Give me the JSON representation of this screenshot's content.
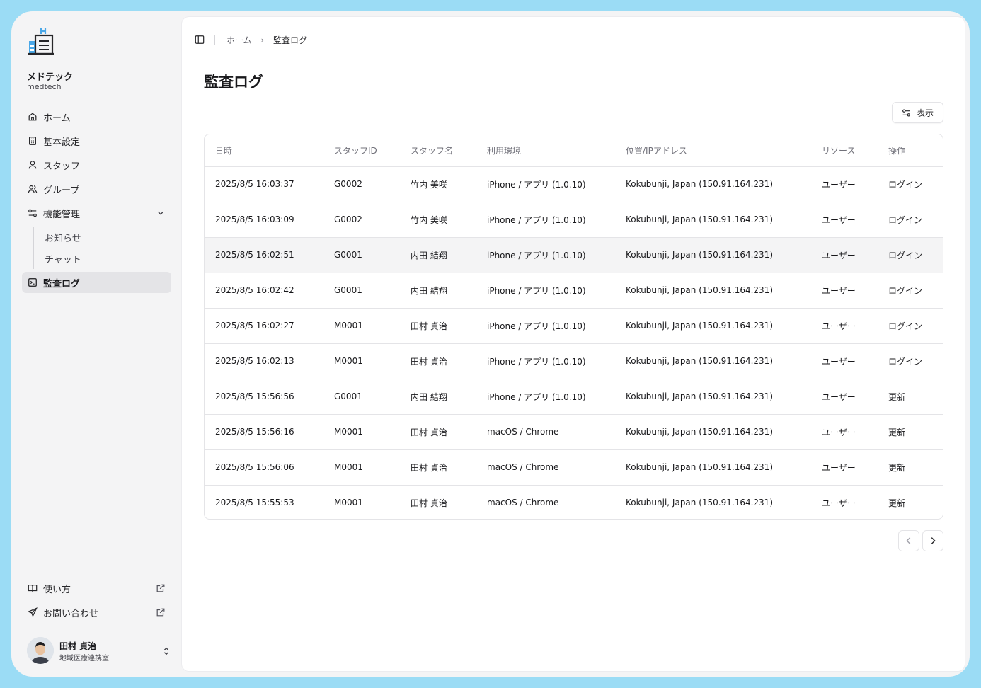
{
  "brand": {
    "name": "メドテック",
    "sub": "medtech"
  },
  "sidebar": {
    "items": [
      {
        "label": "ホーム",
        "icon": "home-icon"
      },
      {
        "label": "基本設定",
        "icon": "building-icon"
      },
      {
        "label": "スタッフ",
        "icon": "user-icon"
      },
      {
        "label": "グループ",
        "icon": "users-icon"
      },
      {
        "label": "機能管理",
        "icon": "sliders-icon"
      },
      {
        "label": "監査ログ",
        "icon": "terminal-icon"
      }
    ],
    "sub_items": [
      "お知らせ",
      "チャット"
    ],
    "bottom": [
      {
        "label": "使い方",
        "icon": "book-icon"
      },
      {
        "label": "お問い合わせ",
        "icon": "send-icon"
      }
    ]
  },
  "user": {
    "name": "田村 貞治",
    "org": "地域医療連携室"
  },
  "breadcrumb": {
    "home": "ホーム",
    "current": "監査ログ"
  },
  "page": {
    "title": "監査ログ",
    "view_button": "表示"
  },
  "table": {
    "headers": [
      "日時",
      "スタッフID",
      "スタッフ名",
      "利用環境",
      "位置/IPアドレス",
      "リソース",
      "操作"
    ],
    "rows": [
      [
        "2025/8/5 16:03:37",
        "G0002",
        "竹内 美咲",
        "iPhone / アプリ (1.0.10)",
        "Kokubunji, Japan (150.91.164.231)",
        "ユーザー",
        "ログイン"
      ],
      [
        "2025/8/5 16:03:09",
        "G0002",
        "竹内 美咲",
        "iPhone / アプリ (1.0.10)",
        "Kokubunji, Japan (150.91.164.231)",
        "ユーザー",
        "ログイン"
      ],
      [
        "2025/8/5 16:02:51",
        "G0001",
        "内田 結翔",
        "iPhone / アプリ (1.0.10)",
        "Kokubunji, Japan (150.91.164.231)",
        "ユーザー",
        "ログイン"
      ],
      [
        "2025/8/5 16:02:42",
        "G0001",
        "内田 結翔",
        "iPhone / アプリ (1.0.10)",
        "Kokubunji, Japan (150.91.164.231)",
        "ユーザー",
        "ログイン"
      ],
      [
        "2025/8/5 16:02:27",
        "M0001",
        "田村 貞治",
        "iPhone / アプリ (1.0.10)",
        "Kokubunji, Japan (150.91.164.231)",
        "ユーザー",
        "ログイン"
      ],
      [
        "2025/8/5 16:02:13",
        "M0001",
        "田村 貞治",
        "iPhone / アプリ (1.0.10)",
        "Kokubunji, Japan (150.91.164.231)",
        "ユーザー",
        "ログイン"
      ],
      [
        "2025/8/5 15:56:56",
        "G0001",
        "内田 結翔",
        "iPhone / アプリ (1.0.10)",
        "Kokubunji, Japan (150.91.164.231)",
        "ユーザー",
        "更新"
      ],
      [
        "2025/8/5 15:56:16",
        "M0001",
        "田村 貞治",
        "macOS / Chrome",
        "Kokubunji, Japan (150.91.164.231)",
        "ユーザー",
        "更新"
      ],
      [
        "2025/8/5 15:56:06",
        "M0001",
        "田村 貞治",
        "macOS / Chrome",
        "Kokubunji, Japan (150.91.164.231)",
        "ユーザー",
        "更新"
      ],
      [
        "2025/8/5 15:55:53",
        "M0001",
        "田村 貞治",
        "macOS / Chrome",
        "Kokubunji, Japan (150.91.164.231)",
        "ユーザー",
        "更新"
      ]
    ],
    "highlighted_row": 2
  },
  "colors": {
    "frame_border": "#9bdcf5",
    "logo_blue": "#4aa8e8",
    "active_bg": "#e4e4e7"
  }
}
